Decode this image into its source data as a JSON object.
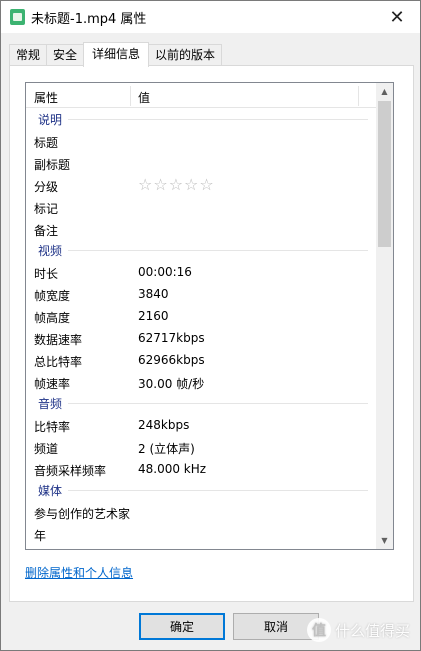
{
  "window": {
    "title": "未标题-1.mp4 属性",
    "close_glyph": "✕"
  },
  "tabs": [
    {
      "label": "常规"
    },
    {
      "label": "安全"
    },
    {
      "label": "详细信息",
      "active": true
    },
    {
      "label": "以前的版本"
    }
  ],
  "list": {
    "header": {
      "property": "属性",
      "value": "值"
    },
    "sections": {
      "description": {
        "label": "说明",
        "rows": [
          {
            "k": "标题",
            "v": ""
          },
          {
            "k": "副标题",
            "v": ""
          },
          {
            "k": "分级",
            "stars": "☆☆☆☆☆",
            "rating": 0
          },
          {
            "k": "标记",
            "v": ""
          },
          {
            "k": "备注",
            "v": ""
          }
        ]
      },
      "video": {
        "label": "视频",
        "rows": [
          {
            "k": "时长",
            "v": "00:00:16"
          },
          {
            "k": "帧宽度",
            "v": "3840"
          },
          {
            "k": "帧高度",
            "v": "2160"
          },
          {
            "k": "数据速率",
            "v": "62717kbps"
          },
          {
            "k": "总比特率",
            "v": "62966kbps"
          },
          {
            "k": "帧速率",
            "v": "30.00 帧/秒"
          }
        ]
      },
      "audio": {
        "label": "音频",
        "rows": [
          {
            "k": "比特率",
            "v": "248kbps"
          },
          {
            "k": "频道",
            "v": "2 (立体声)"
          },
          {
            "k": "音频采样频率",
            "v": "48.000 kHz"
          }
        ]
      },
      "media": {
        "label": "媒体",
        "rows": [
          {
            "k": "参与创作的艺术家",
            "v": ""
          },
          {
            "k": "年",
            "v": ""
          }
        ]
      }
    }
  },
  "link": "删除属性和个人信息",
  "buttons": {
    "ok": "确定",
    "cancel": "取消"
  },
  "watermark": {
    "text": "什么值得买",
    "icon_label": "值"
  },
  "colors": {
    "section_label": "#1e3287",
    "link": "#0066cc",
    "ok_border": "#0078d7"
  }
}
